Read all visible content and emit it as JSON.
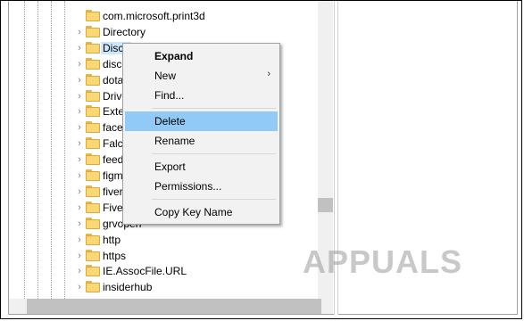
{
  "tree": {
    "items": [
      {
        "label": "com.microsoft.print3d",
        "expandable": false
      },
      {
        "label": "Directory",
        "expandable": true
      },
      {
        "label": "Disco",
        "expandable": true,
        "selected": true
      },
      {
        "label": "disco",
        "expandable": true
      },
      {
        "label": "dota",
        "expandable": true
      },
      {
        "label": "Drive",
        "expandable": true
      },
      {
        "label": "Exte",
        "expandable": true
      },
      {
        "label": "face",
        "expandable": true
      },
      {
        "label": "Falc",
        "expandable": true
      },
      {
        "label": "feed",
        "expandable": true
      },
      {
        "label": "figm",
        "expandable": true
      },
      {
        "label": "fiver",
        "expandable": true
      },
      {
        "label": "Five",
        "expandable": true
      },
      {
        "label": "grvopen",
        "expandable": true
      },
      {
        "label": "http",
        "expandable": true
      },
      {
        "label": "https",
        "expandable": true
      },
      {
        "label": "IE.AssocFile.URL",
        "expandable": true
      },
      {
        "label": "insiderhub",
        "expandable": true
      }
    ]
  },
  "context_menu": {
    "expand": "Expand",
    "new": "New",
    "find": "Find...",
    "delete": "Delete",
    "rename": "Rename",
    "export": "Export",
    "permissions": "Permissions...",
    "copy_key_name": "Copy Key Name"
  },
  "icons": {
    "folder": "folder-icon",
    "chevron": "chevron-right-icon",
    "submenu": "submenu-arrow-icon"
  },
  "colors": {
    "menu_highlight": "#91c9f7",
    "folder": "#f8d774",
    "selection": "#cce8ff"
  },
  "watermark": "APPUALS"
}
